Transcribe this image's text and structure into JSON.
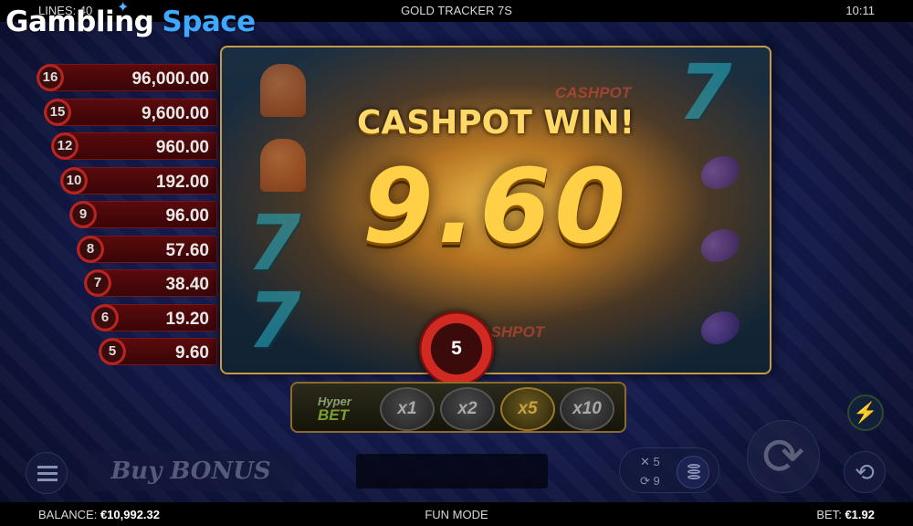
{
  "brand": {
    "word1": "Gambling",
    "word2": "Space"
  },
  "topbar": {
    "lines": "LINES: 40",
    "title": "GOLD TRACKER 7S",
    "clock": "10:11"
  },
  "ladder": [
    {
      "count": "16",
      "amount": "96,000.00"
    },
    {
      "count": "15",
      "amount": "9,600.00"
    },
    {
      "count": "12",
      "amount": "960.00"
    },
    {
      "count": "10",
      "amount": "192.00"
    },
    {
      "count": "9",
      "amount": "96.00"
    },
    {
      "count": "8",
      "amount": "57.60"
    },
    {
      "count": "7",
      "amount": "38.40"
    },
    {
      "count": "6",
      "amount": "19.20"
    },
    {
      "count": "5",
      "amount": "9.60"
    }
  ],
  "reels": {
    "cashpot_label": "CASHPOT",
    "seven_symbol": "7"
  },
  "win": {
    "heading": "CASHPOT WIN!",
    "amount": "9.60",
    "counter": "5"
  },
  "hyperbet": {
    "label_top": "Hyper",
    "label_bottom": "BET",
    "multipliers": [
      "x1",
      "x2",
      "x5",
      "x10"
    ],
    "active_multiplier": "x5"
  },
  "controls": {
    "buy_bonus": "Buy BONUS",
    "autoplay_multiplier": "✕ 5",
    "autoplay_count": "⟳ 9",
    "spin_icon": "refresh-icon",
    "bolt_icon": "bolt-icon",
    "auto_icon": "autoplay-icon"
  },
  "bottombar": {
    "balance_label": "BALANCE:",
    "balance_value": "€10,992.32",
    "mode": "FUN MODE",
    "bet_label": "BET:",
    "bet_value": "€1.92"
  },
  "colors": {
    "gold": "#ffcf45",
    "accent_blue": "#3fa8ff",
    "ladder_red": "#5a0a0c"
  }
}
